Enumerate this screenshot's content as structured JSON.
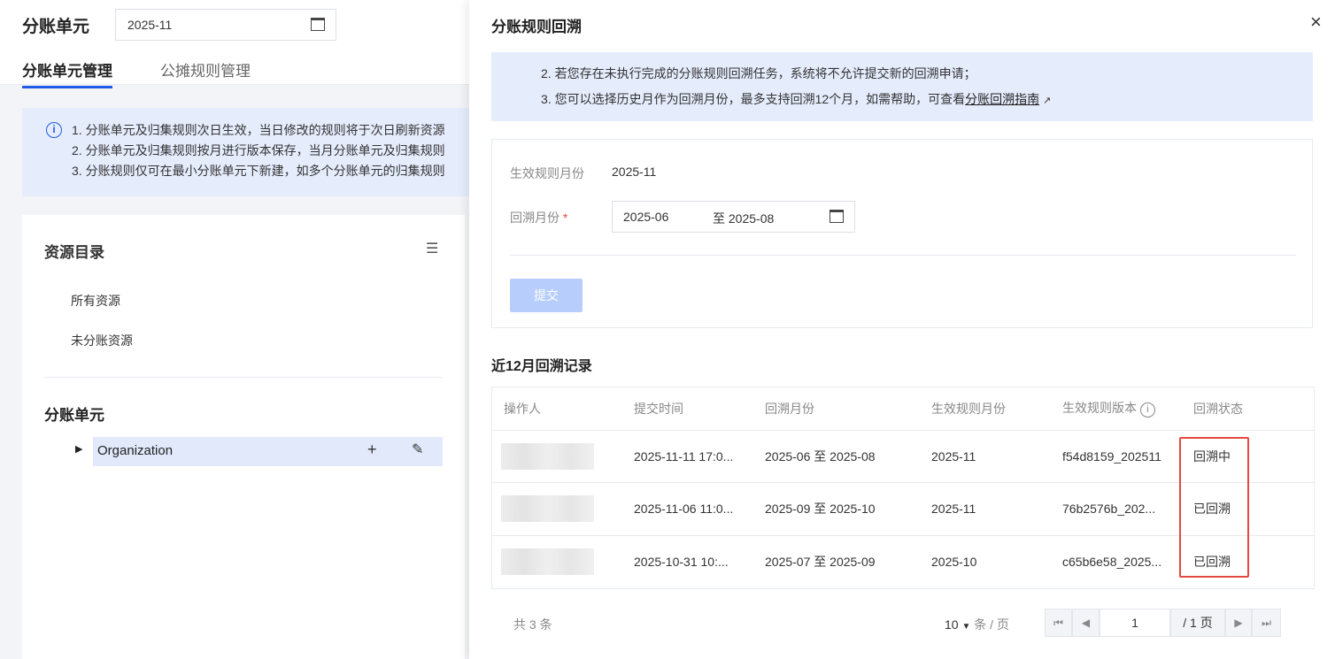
{
  "page": {
    "title": "分账单元",
    "month": "2025-11",
    "tabs": [
      "分账单元管理",
      "公摊规则管理"
    ],
    "notices": [
      "1. 分账单元及归集规则次日生效，当日修改的规则将于次日刷新资源",
      "2. 分账单元及归集规则按月进行版本保存，当月分账单元及归集规则",
      "3. 分账规则仅可在最小分账单元下新建，如多个分账单元的归集规则"
    ]
  },
  "sidebar": {
    "title": "资源目录",
    "items": [
      "所有资源",
      "未分账资源"
    ],
    "unit_title": "分账单元",
    "tree_node": "Organization"
  },
  "drawer": {
    "title": "分账规则回溯",
    "notices": [
      "2. 若您存在未执行完成的分账规则回溯任务，系统将不允许提交新的回溯申请；",
      "3. 您可以选择历史月作为回溯月份，最多支持回溯12个月，如需帮助，可查看"
    ],
    "guide_link": "分账回溯指南",
    "form": {
      "rule_month_label": "生效规则月份",
      "rule_month": "2025-11",
      "range_label": "回溯月份",
      "required": "*",
      "start": "2025-06",
      "sep": "至",
      "end": "2025-08",
      "submit": "提交"
    },
    "records_title": "近12月回溯记录",
    "columns": [
      "操作人",
      "提交时间",
      "回溯月份",
      "生效规则月份",
      "生效规则版本",
      "回溯状态"
    ],
    "rows": [
      {
        "submit_time": "2025-11-11 17:0...",
        "range": "2025-06 至 2025-08",
        "rule_month": "2025-11",
        "version": "f54d8159_202511",
        "status": "回溯中"
      },
      {
        "submit_time": "2025-11-06 11:0...",
        "range": "2025-09 至 2025-10",
        "rule_month": "2025-11",
        "version": "76b2576b_202...",
        "status": "已回溯"
      },
      {
        "submit_time": "2025-10-31 10:...",
        "range": "2025-07 至 2025-09",
        "rule_month": "2025-10",
        "version": "c65b6e58_2025...",
        "status": "已回溯"
      }
    ],
    "pagination": {
      "total": "共 3 条",
      "page_size": "10",
      "per_page": "条 / 页",
      "page": "1",
      "total_pages": "/ 1 页"
    }
  }
}
